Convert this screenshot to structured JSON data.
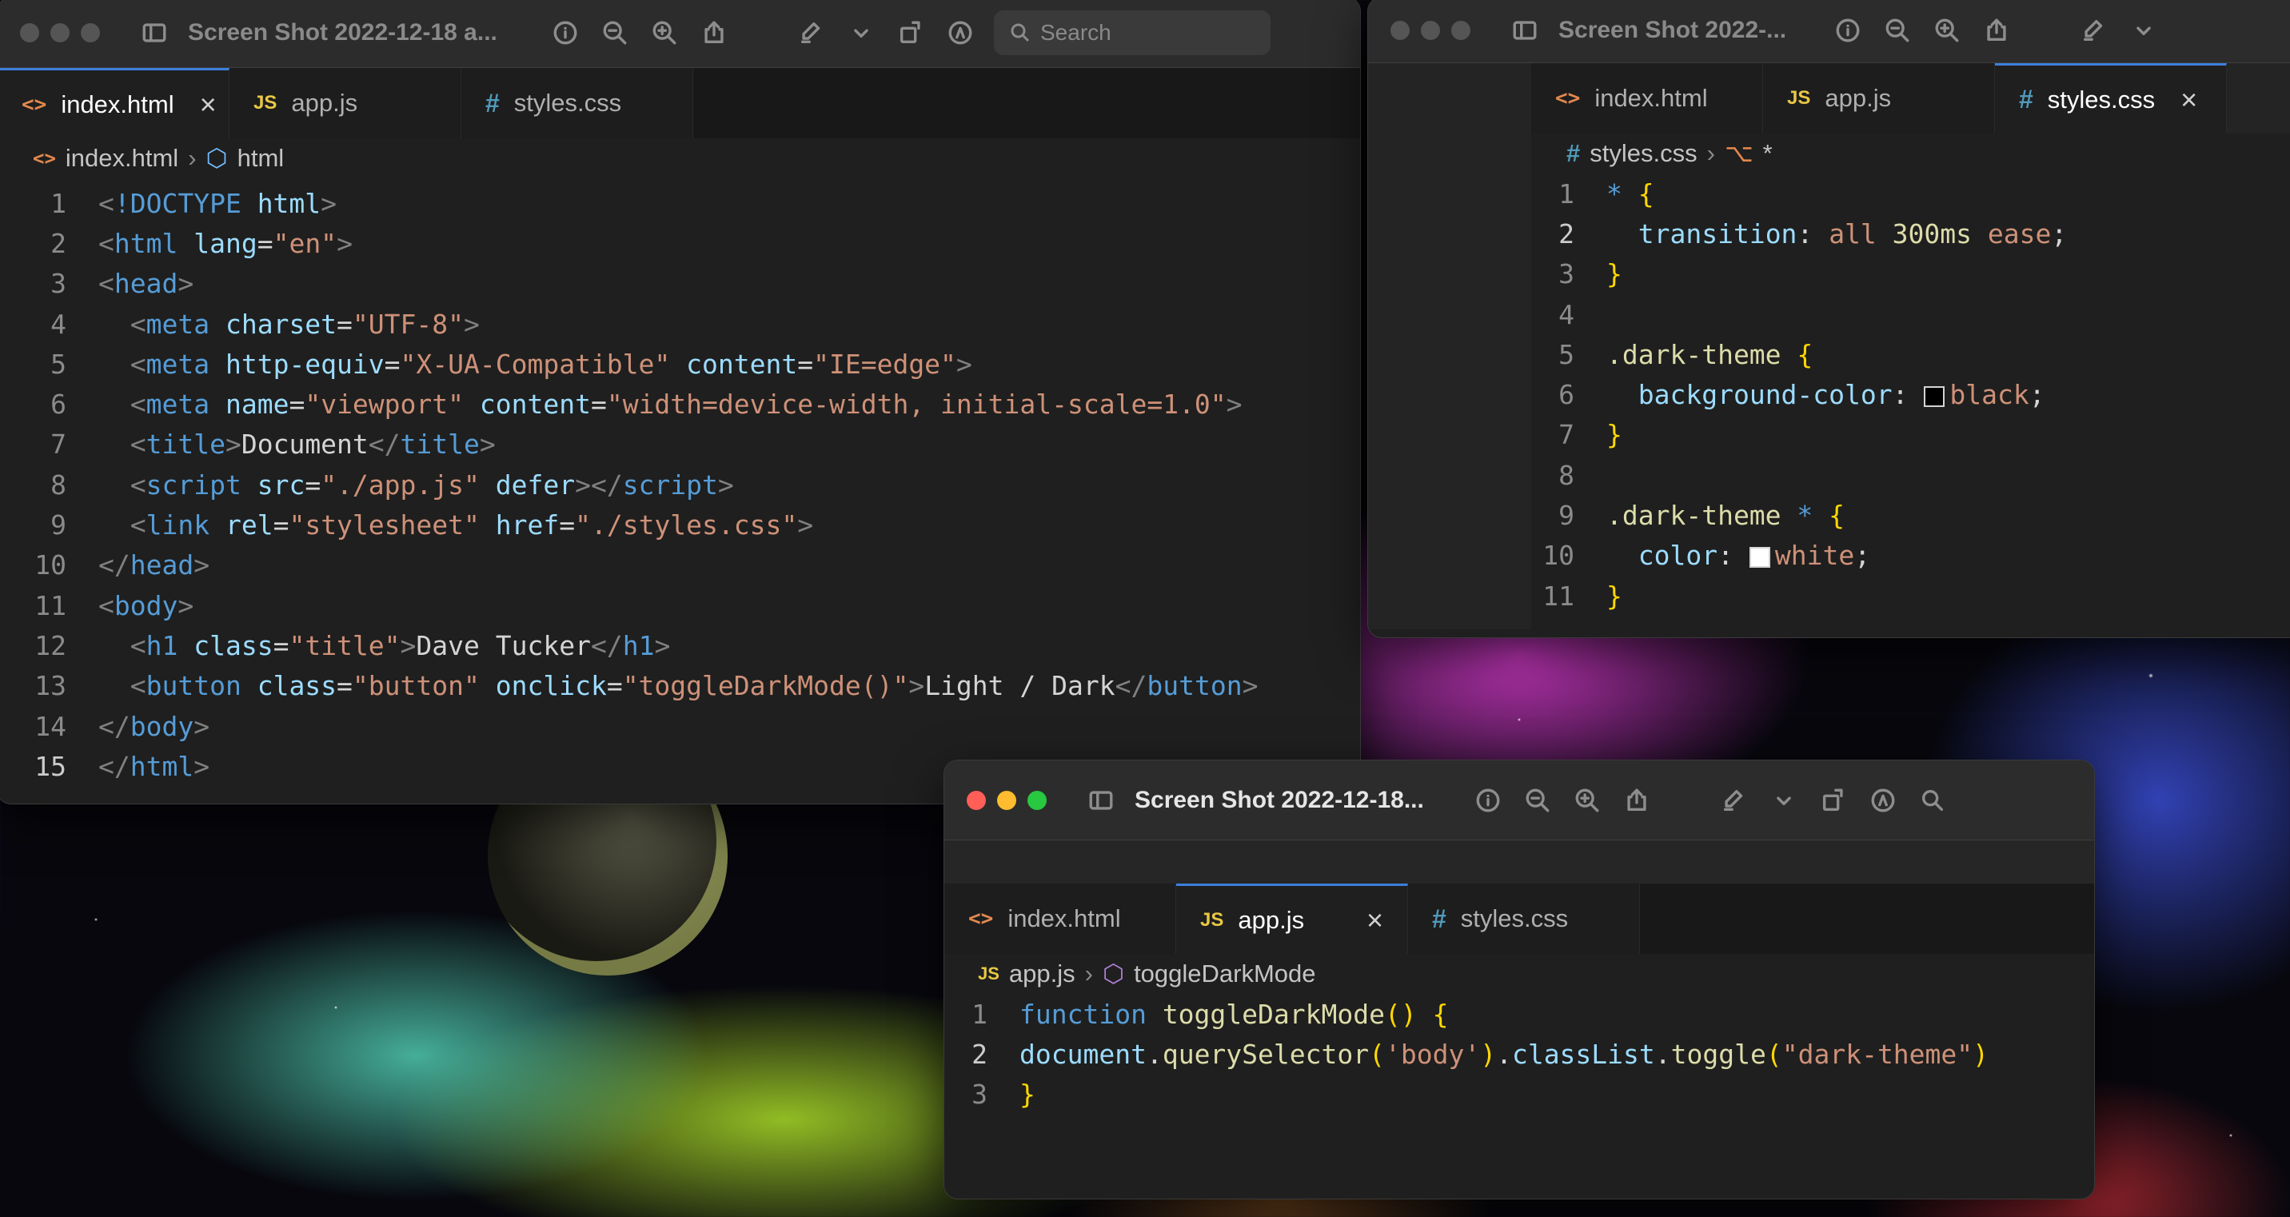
{
  "windows": {
    "main": {
      "title": "Screen Shot 2022-12-18 a...",
      "search_placeholder": "Search",
      "tabs": [
        {
          "icon": "<>",
          "label": "index.html",
          "close": "×"
        },
        {
          "icon": "JS",
          "label": "app.js"
        },
        {
          "icon": "#",
          "label": "styles.css"
        }
      ],
      "breadcrumb": {
        "file": "index.html",
        "symbol": "html"
      },
      "lines": [
        {
          "n": "1",
          "cur": false,
          "parts": [
            [
              "br",
              "<"
            ],
            [
              "tg",
              "!DOCTYPE "
            ],
            [
              "at",
              "html"
            ],
            [
              "br",
              ">"
            ]
          ]
        },
        {
          "n": "2",
          "cur": false,
          "parts": [
            [
              "br",
              "<"
            ],
            [
              "tg",
              "html "
            ],
            [
              "at",
              "lang"
            ],
            [
              "tx",
              "="
            ],
            [
              "st",
              "\"en\""
            ],
            [
              "br",
              ">"
            ]
          ]
        },
        {
          "n": "3",
          "cur": false,
          "parts": [
            [
              "br",
              "<"
            ],
            [
              "tg",
              "head"
            ],
            [
              "br",
              ">"
            ]
          ]
        },
        {
          "n": "4",
          "cur": false,
          "parts": [
            [
              "tx",
              "  "
            ],
            [
              "br",
              "<"
            ],
            [
              "tg",
              "meta "
            ],
            [
              "at",
              "charset"
            ],
            [
              "tx",
              "="
            ],
            [
              "st",
              "\"UTF-8\""
            ],
            [
              "br",
              ">"
            ]
          ]
        },
        {
          "n": "5",
          "cur": false,
          "parts": [
            [
              "tx",
              "  "
            ],
            [
              "br",
              "<"
            ],
            [
              "tg",
              "meta "
            ],
            [
              "at",
              "http-equiv"
            ],
            [
              "tx",
              "="
            ],
            [
              "st",
              "\"X-UA-Compatible\" "
            ],
            [
              "at",
              "content"
            ],
            [
              "tx",
              "="
            ],
            [
              "st",
              "\"IE=edge\""
            ],
            [
              "br",
              ">"
            ]
          ]
        },
        {
          "n": "6",
          "cur": false,
          "parts": [
            [
              "tx",
              "  "
            ],
            [
              "br",
              "<"
            ],
            [
              "tg",
              "meta "
            ],
            [
              "at",
              "name"
            ],
            [
              "tx",
              "="
            ],
            [
              "st",
              "\"viewport\" "
            ],
            [
              "at",
              "content"
            ],
            [
              "tx",
              "="
            ],
            [
              "st",
              "\"width=device-width, initial-scale=1.0\""
            ],
            [
              "br",
              ">"
            ]
          ]
        },
        {
          "n": "7",
          "cur": false,
          "parts": [
            [
              "tx",
              "  "
            ],
            [
              "br",
              "<"
            ],
            [
              "tg",
              "title"
            ],
            [
              "br",
              ">"
            ],
            [
              "tx",
              "Document"
            ],
            [
              "br",
              "</"
            ],
            [
              "tg",
              "title"
            ],
            [
              "br",
              ">"
            ]
          ]
        },
        {
          "n": "8",
          "cur": false,
          "parts": [
            [
              "tx",
              "  "
            ],
            [
              "br",
              "<"
            ],
            [
              "tg",
              "script "
            ],
            [
              "at",
              "src"
            ],
            [
              "tx",
              "="
            ],
            [
              "st",
              "\"./app.js\" "
            ],
            [
              "at",
              "defer"
            ],
            [
              "br",
              "></"
            ],
            [
              "tg",
              "script"
            ],
            [
              "br",
              ">"
            ]
          ]
        },
        {
          "n": "9",
          "cur": false,
          "parts": [
            [
              "tx",
              "  "
            ],
            [
              "br",
              "<"
            ],
            [
              "tg",
              "link "
            ],
            [
              "at",
              "rel"
            ],
            [
              "tx",
              "="
            ],
            [
              "st",
              "\"stylesheet\" "
            ],
            [
              "at",
              "href"
            ],
            [
              "tx",
              "="
            ],
            [
              "st",
              "\"./styles.css\""
            ],
            [
              "br",
              ">"
            ]
          ]
        },
        {
          "n": "10",
          "cur": false,
          "parts": [
            [
              "br",
              "</"
            ],
            [
              "tg",
              "head"
            ],
            [
              "br",
              ">"
            ]
          ]
        },
        {
          "n": "11",
          "cur": false,
          "parts": [
            [
              "br",
              "<"
            ],
            [
              "tg",
              "body"
            ],
            [
              "br",
              ">"
            ]
          ]
        },
        {
          "n": "12",
          "cur": false,
          "parts": [
            [
              "tx",
              "  "
            ],
            [
              "br",
              "<"
            ],
            [
              "tg",
              "h1 "
            ],
            [
              "at",
              "class"
            ],
            [
              "tx",
              "="
            ],
            [
              "st",
              "\"title\""
            ],
            [
              "br",
              ">"
            ],
            [
              "tx",
              "Dave Tucker"
            ],
            [
              "br",
              "</"
            ],
            [
              "tg",
              "h1"
            ],
            [
              "br",
              ">"
            ]
          ]
        },
        {
          "n": "13",
          "cur": false,
          "parts": [
            [
              "tx",
              "  "
            ],
            [
              "br",
              "<"
            ],
            [
              "tg",
              "button "
            ],
            [
              "at",
              "class"
            ],
            [
              "tx",
              "="
            ],
            [
              "st",
              "\"button\" "
            ],
            [
              "at",
              "onclick"
            ],
            [
              "tx",
              "="
            ],
            [
              "st",
              "\"toggleDarkMode()\""
            ],
            [
              "br",
              ">"
            ],
            [
              "tx",
              "Light / Dark"
            ],
            [
              "br",
              "</"
            ],
            [
              "tg",
              "button"
            ],
            [
              "br",
              ">"
            ]
          ]
        },
        {
          "n": "14",
          "cur": false,
          "parts": [
            [
              "br",
              "</"
            ],
            [
              "tg",
              "body"
            ],
            [
              "br",
              ">"
            ]
          ]
        },
        {
          "n": "15",
          "cur": true,
          "parts": [
            [
              "br",
              "</"
            ],
            [
              "tg",
              "html"
            ],
            [
              "br",
              ">"
            ]
          ]
        }
      ]
    },
    "css": {
      "title": "Screen Shot 2022-...",
      "tabs": [
        {
          "icon": "<>",
          "label": "index.html"
        },
        {
          "icon": "JS",
          "label": "app.js"
        },
        {
          "icon": "#",
          "label": "styles.css",
          "close": "×"
        }
      ],
      "breadcrumb": {
        "file": "styles.css",
        "symbol": "*"
      },
      "lines": [
        {
          "n": "1",
          "cur": false,
          "parts": [
            [
              "kw",
              "* "
            ],
            [
              "br1",
              "{"
            ]
          ]
        },
        {
          "n": "2",
          "cur": true,
          "parts": [
            [
              "tx",
              "  "
            ],
            [
              "pl",
              "transition"
            ],
            [
              "tx",
              ": "
            ],
            [
              "st",
              "all "
            ],
            [
              "fn",
              "300ms "
            ],
            [
              "st",
              "ease"
            ],
            [
              "tx",
              ";"
            ]
          ]
        },
        {
          "n": "3",
          "cur": false,
          "parts": [
            [
              "br1",
              "}"
            ]
          ]
        },
        {
          "n": "4",
          "cur": false,
          "parts": [
            [
              "tx",
              ""
            ]
          ]
        },
        {
          "n": "5",
          "cur": false,
          "parts": [
            [
              "fn",
              ".dark-theme "
            ],
            [
              "br1",
              "{"
            ]
          ]
        },
        {
          "n": "6",
          "cur": false,
          "parts": [
            [
              "tx",
              "  "
            ],
            [
              "pl",
              "background-color"
            ],
            [
              "tx",
              ": "
            ],
            [
              "sw",
              "black"
            ],
            [
              "st",
              "black"
            ],
            [
              "tx",
              ";"
            ]
          ]
        },
        {
          "n": "7",
          "cur": false,
          "parts": [
            [
              "br1",
              "}"
            ]
          ]
        },
        {
          "n": "8",
          "cur": false,
          "parts": [
            [
              "tx",
              ""
            ]
          ]
        },
        {
          "n": "9",
          "cur": false,
          "parts": [
            [
              "fn",
              ".dark-theme "
            ],
            [
              "kw",
              "* "
            ],
            [
              "br1",
              "{"
            ]
          ]
        },
        {
          "n": "10",
          "cur": false,
          "parts": [
            [
              "tx",
              "  "
            ],
            [
              "pl",
              "color"
            ],
            [
              "tx",
              ": "
            ],
            [
              "sw",
              "white"
            ],
            [
              "st",
              "white"
            ],
            [
              "tx",
              ";"
            ]
          ]
        },
        {
          "n": "11",
          "cur": false,
          "parts": [
            [
              "br1",
              "}"
            ]
          ]
        }
      ]
    },
    "js": {
      "title": "Screen Shot 2022-12-18...",
      "tabs": [
        {
          "icon": "<>",
          "label": "index.html"
        },
        {
          "icon": "JS",
          "label": "app.js",
          "close": "×"
        },
        {
          "icon": "#",
          "label": "styles.css"
        }
      ],
      "breadcrumb": {
        "file": "app.js",
        "symbol": "toggleDarkMode"
      },
      "lines": [
        {
          "n": "1",
          "cur": false,
          "parts": [
            [
              "kw",
              "function "
            ],
            [
              "fn",
              "toggleDarkMode"
            ],
            [
              "br1",
              "() {"
            ]
          ]
        },
        {
          "n": "2",
          "cur": true,
          "parts": [
            [
              "pl",
              "document"
            ],
            [
              "tx",
              "."
            ],
            [
              "fn",
              "querySelector"
            ],
            [
              "br1",
              "("
            ],
            [
              "st",
              "'body'"
            ],
            [
              "br1",
              ")"
            ],
            [
              "tx",
              "."
            ],
            [
              "pl",
              "classList"
            ],
            [
              "tx",
              "."
            ],
            [
              "fn",
              "toggle"
            ],
            [
              "br1",
              "("
            ],
            [
              "st",
              "\"dark-theme\""
            ],
            [
              "br1",
              ")"
            ]
          ]
        },
        {
          "n": "3",
          "cur": false,
          "parts": [
            [
              "br1",
              "}"
            ]
          ]
        }
      ]
    }
  }
}
